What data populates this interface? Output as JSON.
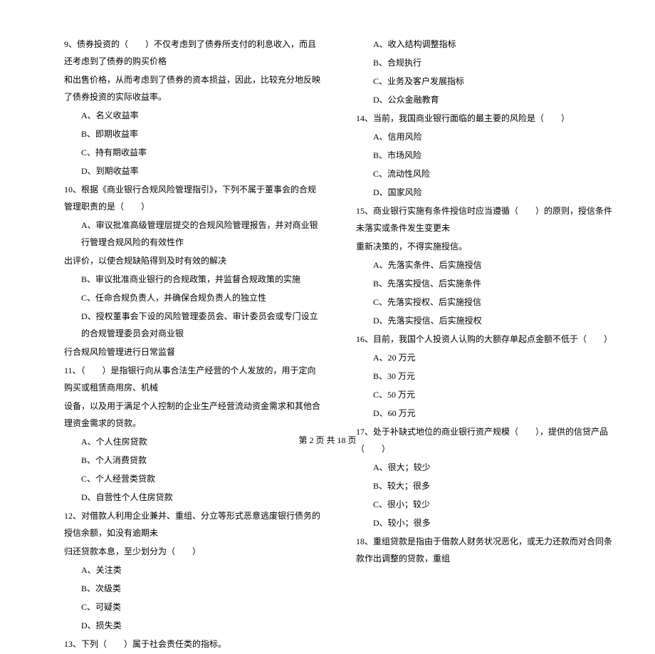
{
  "left_column": {
    "q9": {
      "text_parts": [
        "9、债券投资的（　　）不仅考虑到了债券所支付的利息收入，而且还考虑到了债券的购买价格",
        "和出售价格，从而考虑到了债券的资本损益，因此，比较充分地反映了债券投资的实际收益率。"
      ],
      "options": [
        "A、名义收益率",
        "B、即期收益率",
        "C、持有期收益率",
        "D、到期收益率"
      ]
    },
    "q10": {
      "text": "10、根据《商业银行合规风险管理指引》，下列不属于董事会的合规管理职责的是（　　）",
      "options": [
        "A、审议批准高级管理层提交的合规风险管理报告，并对商业银行管理合规风险的有效性作",
        "出评价，以使合规缺陷得到及时有效的解决",
        "B、审议批准商业银行的合规政策，并监督合规政策的实施",
        "C、任命合规负责人，并确保合规负责人的独立性",
        "D、授权董事会下设的风险管理委员会、审计委员会或专门设立的合规管理委员会对商业银",
        "行合规风险管理进行日常监督"
      ]
    },
    "q11": {
      "text_parts": [
        "11、（　　）是指银行向从事合法生产经营的个人发放的，用于定向购买或租赁商用房、机械",
        "设备，以及用于满足个人控制的企业生产经营流动资金需求和其他合理资金需求的贷款。"
      ],
      "options": [
        "A、个人住房贷款",
        "B、个人消费贷款",
        "C、个人经营类贷款",
        "D、自营性个人住房贷款"
      ]
    },
    "q12": {
      "text_parts": [
        "12、对借款人利用企业兼并、重组、分立等形式恶意逃废银行债务的授信余额，如没有逾期未",
        "归还贷款本息，至少划分为（　　）"
      ],
      "options": [
        "A、关注类",
        "B、次级类",
        "C、可疑类",
        "D、损失类"
      ]
    },
    "q13": {
      "text": "13、下列（　　）属于社会责任类的指标。"
    }
  },
  "right_column": {
    "q13_options": [
      "A、收入结构调整指标",
      "B、合规执行",
      "C、业务及客户发展指标",
      "D、公众金融教育"
    ],
    "q14": {
      "text": "14、当前，我国商业银行面临的最主要的风险是（　　）",
      "options": [
        "A、信用风险",
        "B、市场风险",
        "C、流动性风险",
        "D、国家风险"
      ]
    },
    "q15": {
      "text_parts": [
        "15、商业银行实施有条件授信时应当遵循（　　）的原则，授信条件未落实或条件发生变更未",
        "重新决策的，不得实施授信。"
      ],
      "options": [
        "A、先落实条件、后实施授信",
        "B、先落实授信、后实施条件",
        "C、先落实授权、后实施授信",
        "D、先落实授信、后实施授权"
      ]
    },
    "q16": {
      "text": "16、目前，我国个人投资人认购的大额存单起点金额不低于（　　）",
      "options": [
        "A、20 万元",
        "B、30 万元",
        "C、50 万元",
        "D、60 万元"
      ]
    },
    "q17": {
      "text": "17、处于补缺式地位的商业银行资产规模（　　），提供的信贷产品（　　）",
      "options": [
        "A、很大；较少",
        "B、较大；很多",
        "C、很小；较少",
        "D、较小；很多"
      ]
    },
    "q18": {
      "text": "18、重组贷款是指由于借款人财务状况恶化，或无力还款而对合同条款作出调整的贷款，重组"
    }
  },
  "footer": "第 2 页 共 18 页"
}
